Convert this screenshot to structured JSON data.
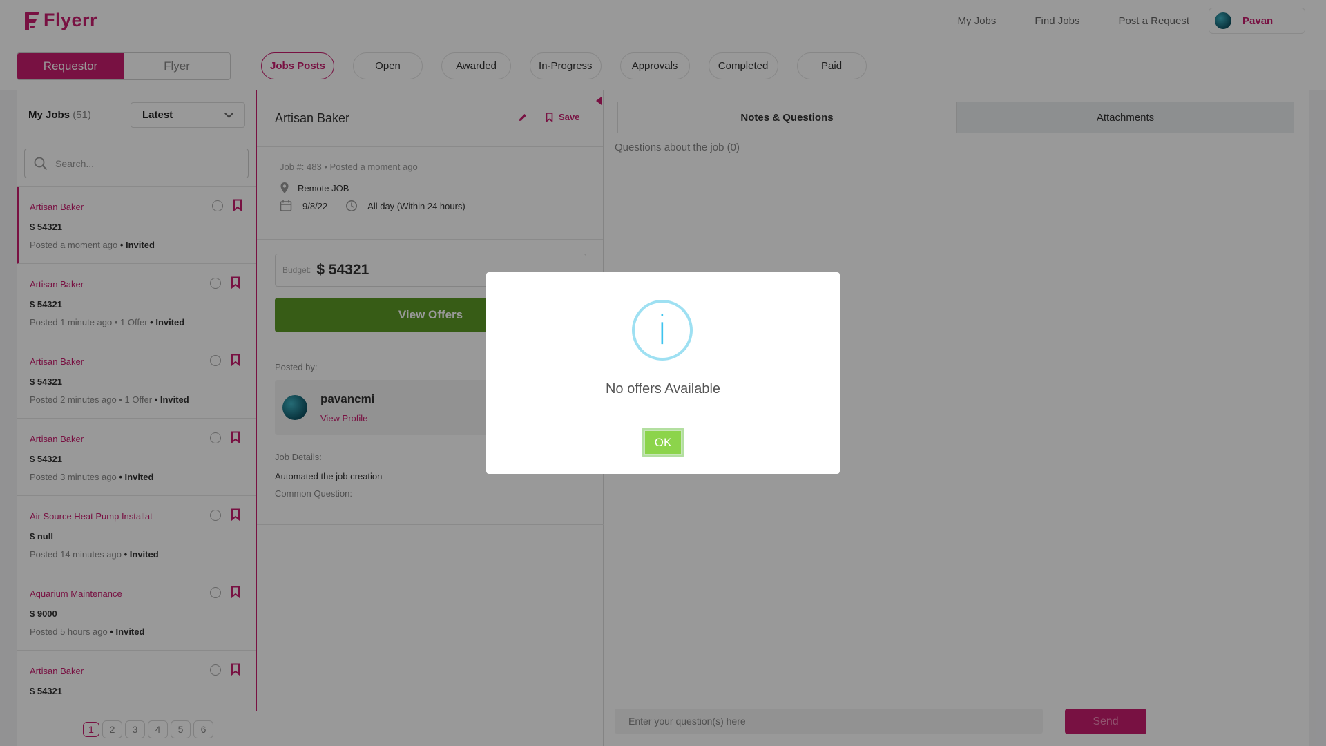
{
  "brand": {
    "name": "Flyerr",
    "color": "#c81d6e"
  },
  "topnav": {
    "links": [
      "My Jobs",
      "Find Jobs",
      "Post a Request"
    ],
    "user": "Pavan"
  },
  "filterbar": {
    "roles": [
      "Requestor",
      "Flyer"
    ],
    "active_role": "Requestor",
    "tabs": [
      "Jobs Posts",
      "Open",
      "Awarded",
      "In-Progress",
      "Approvals",
      "Completed",
      "Paid"
    ],
    "active_tab": "Jobs Posts"
  },
  "joblist": {
    "title": "My Jobs",
    "count": "(51)",
    "sort": "Latest",
    "search_placeholder": "Search...",
    "items": [
      {
        "title": "Artisan Baker",
        "price": "$ 54321",
        "posted": "Posted a moment ago",
        "offers": "",
        "status": "• Invited"
      },
      {
        "title": "Artisan Baker",
        "price": "$ 54321",
        "posted": "Posted 1 minute ago",
        "offers": "• 1 Offer",
        "status": "• Invited"
      },
      {
        "title": "Artisan Baker",
        "price": "$ 54321",
        "posted": "Posted 2 minutes ago",
        "offers": "• 1 Offer",
        "status": "• Invited"
      },
      {
        "title": "Artisan Baker",
        "price": "$ 54321",
        "posted": "Posted 3 minutes ago",
        "offers": "",
        "status": "• Invited"
      },
      {
        "title": "Air Source Heat Pump Installat",
        "price": "$ null",
        "posted": "Posted 14 minutes ago",
        "offers": "",
        "status": "• Invited"
      },
      {
        "title": "Aquarium Maintenance",
        "price": "$ 9000",
        "posted": "Posted 5 hours ago",
        "offers": "",
        "status": "• Invited"
      },
      {
        "title": "Artisan Baker",
        "price": "$ 54321",
        "posted": "",
        "offers": "",
        "status": ""
      }
    ],
    "pages": [
      "1",
      "2",
      "3",
      "4",
      "5",
      "6"
    ],
    "current_page": "1"
  },
  "detail": {
    "title": "Artisan Baker",
    "save_label": "Save",
    "job_meta": "Job #: 483 • Posted a moment ago",
    "location": "Remote JOB",
    "date": "9/8/22",
    "time": "All day (Within 24 hours)",
    "budget_label": "Budget:",
    "budget_value": "$ 54321",
    "view_offers": "View Offers",
    "posted_by_label": "Posted by:",
    "poster_name": "pavancmi",
    "view_profile": "View Profile",
    "job_details_label": "Job Details:",
    "job_details": "Automated the job creation",
    "common_question_label": "Common Question:"
  },
  "right": {
    "tabs": [
      "Notes & Questions",
      "Attachments"
    ],
    "active_tab": "Notes & Questions",
    "questions_label": "Questions about the job (0)",
    "input_placeholder": "Enter your question(s) here",
    "send_label": "Send"
  },
  "modal": {
    "icon": "i",
    "message": "No offers Available",
    "ok_label": "OK"
  }
}
